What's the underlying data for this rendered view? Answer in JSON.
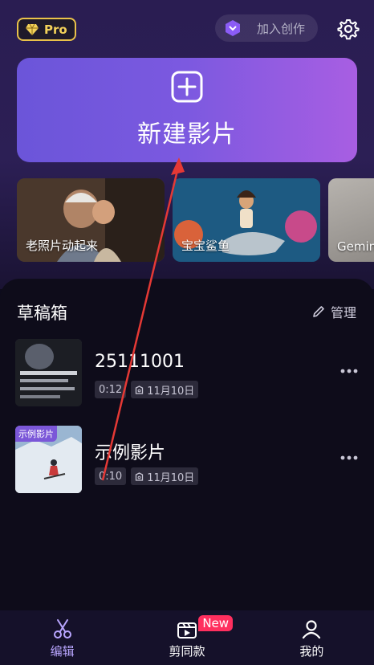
{
  "header": {
    "pro_label": "Pro",
    "create_label": "加入创作",
    "icons": {
      "pro": "diamond-icon",
      "create": "hexagon-chevron-icon",
      "settings": "gear-icon"
    }
  },
  "new_project": {
    "label": "新建影片",
    "icon": "plus-square-icon"
  },
  "templates": [
    {
      "label": "老照片动起来"
    },
    {
      "label": "宝宝鲨鱼"
    },
    {
      "label": "Gemini"
    }
  ],
  "drafts": {
    "title": "草稿箱",
    "manage_label": "管理",
    "items": [
      {
        "title": "25111001",
        "duration": "0:12",
        "date": "11月10日",
        "tag": ""
      },
      {
        "title": "示例影片",
        "duration": "0:10",
        "date": "11月10日",
        "tag": "示例影片"
      }
    ]
  },
  "nav": {
    "items": [
      {
        "label": "编辑",
        "icon": "scissors-icon",
        "active": true
      },
      {
        "label": "剪同款",
        "icon": "clapper-icon",
        "badge": "New"
      },
      {
        "label": "我的",
        "icon": "person-icon"
      }
    ]
  },
  "colors": {
    "accent": "#7b57d8",
    "pro_gold": "#e9c24a",
    "badge_red": "#ff2f5f",
    "annotation_arrow": "#e53935"
  }
}
